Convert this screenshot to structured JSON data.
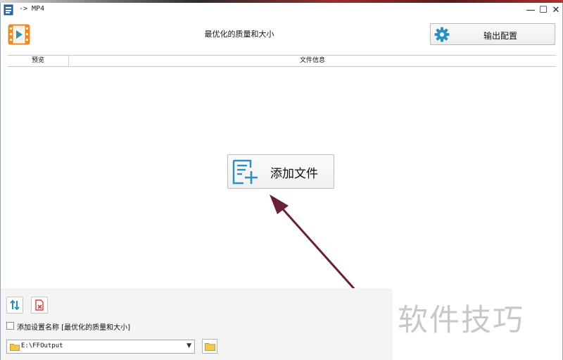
{
  "window": {
    "title": "-> MP4",
    "controls": [
      "minimize",
      "maximize",
      "close"
    ],
    "minimize_glyph": "—",
    "maximize_glyph": "☐",
    "close_glyph": "✕"
  },
  "header": {
    "preset_title": "最优化的质量和大小",
    "output_config_label": "输出配置",
    "logo_icon": "video-file-icon",
    "gear_icon": "gear-icon"
  },
  "file_table": {
    "columns": [
      "预览",
      "文件信息"
    ]
  },
  "main": {
    "add_file_label": "添加文件",
    "add_file_icon": "add-list-icon"
  },
  "bottom": {
    "checkbox_label": "添加设置名称 [最优化的质量和大小]",
    "checkbox_checked": false,
    "output_path": "E:\\FFOutput",
    "dropdown_caret": "▼"
  },
  "watermark": "软件技巧",
  "colors": {
    "accent_orange": "#e88a2a",
    "accent_teal": "#2b8fbf",
    "arrow": "#6b1f35",
    "folder_yellow": "#f2c94c",
    "delete_red": "#d04040"
  }
}
